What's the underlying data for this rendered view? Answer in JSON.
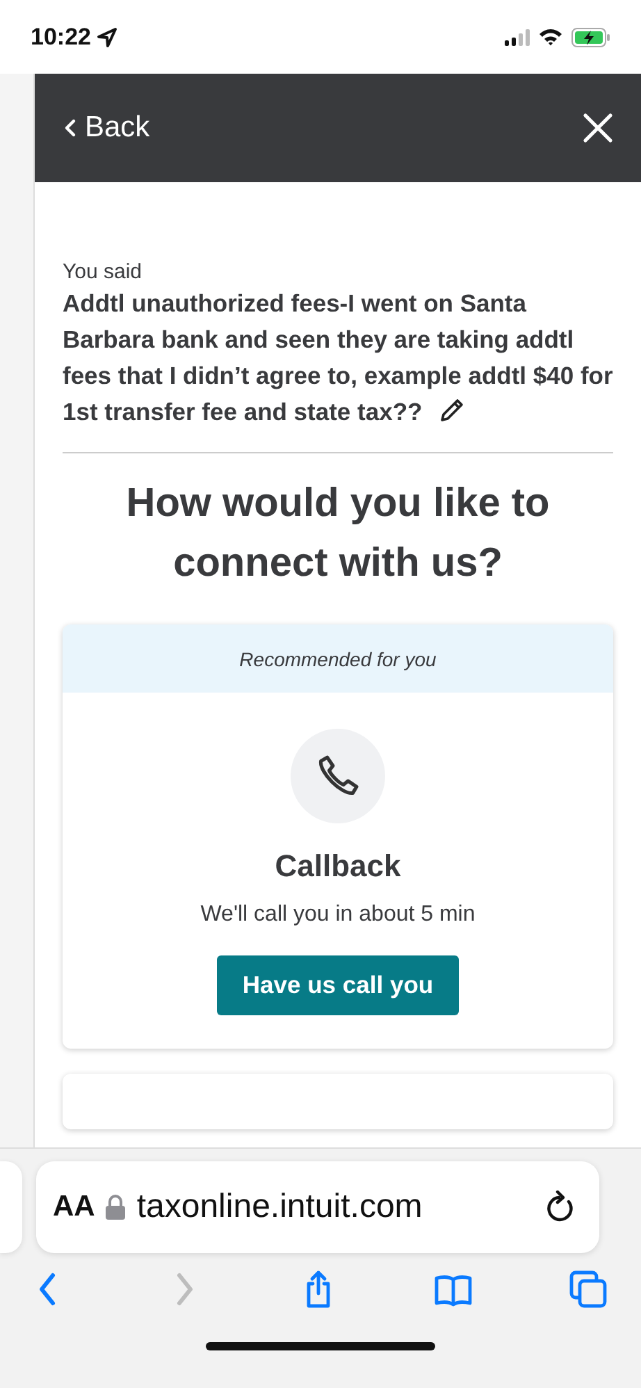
{
  "status_bar": {
    "time": "10:22"
  },
  "header": {
    "back": "Back"
  },
  "message": {
    "label": "You said",
    "text": "Addtl unauthorized fees-I went on Santa Barbara bank and seen they are taking addtl fees that I didn’t agree to, example addtl $40 for 1st transfer fee and state tax??"
  },
  "heading": "How would you like to connect with us?",
  "options": [
    {
      "banner": "Recommended for you",
      "title": "Callback",
      "subtitle": "We'll call you in about 5 min",
      "button": "Have us call you"
    }
  ],
  "browser": {
    "text_size": "AA",
    "url": "taxonline.intuit.com",
    "nav": [
      {
        "kind": "back",
        "disabled": false
      },
      {
        "kind": "forward",
        "disabled": true
      },
      {
        "kind": "share",
        "disabled": false
      },
      {
        "kind": "bookmarks",
        "disabled": false
      },
      {
        "kind": "tabs",
        "disabled": false
      }
    ]
  }
}
